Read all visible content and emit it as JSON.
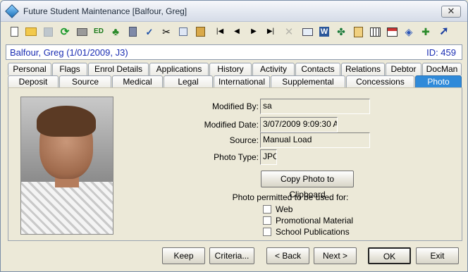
{
  "window": {
    "title": "Future Student Maintenance  [Balfour, Greg]",
    "close_glyph": "✕"
  },
  "toolbar": {
    "icons": [
      "new-doc-icon",
      "open-folder-icon",
      "save-icon",
      "refresh-icon",
      "print-icon",
      "edit-icon",
      "tree-icon",
      "calculator-icon",
      "spellcheck-icon",
      "cut-icon",
      "copy-icon",
      "paste-icon",
      "first-record-icon",
      "previous-record-icon",
      "next-record-icon",
      "last-record-icon",
      "delete-icon",
      "email-icon",
      "word-icon",
      "family-icon",
      "clipboard-icon",
      "calendar-icon",
      "schedule-icon",
      "tag-icon",
      "notes-icon",
      "go-icon"
    ],
    "edit_label": "ED"
  },
  "info": {
    "name": "Balfour, Greg (1/01/2009, J3)",
    "id": "ID: 459"
  },
  "tabs_row1": [
    "Personal",
    "Flags",
    "Enrol Details",
    "Applications",
    "History",
    "Activity",
    "Contacts",
    "Relations",
    "Debtor",
    "DocMan"
  ],
  "tabs_row2": [
    "Deposit",
    "Source",
    "Medical",
    "Legal",
    "International",
    "Supplemental",
    "Concessions",
    "Photo"
  ],
  "active_tab": "Photo",
  "photo_tab": {
    "modified_by_label": "Modified By:",
    "modified_by": "sa",
    "modified_date_label": "Modified Date:",
    "modified_date": "3/07/2009 9:09:30 A",
    "source_label": "Source:",
    "source": "Manual Load",
    "photo_type_label": "Photo Type:",
    "photo_type": "JPG",
    "copy_button": "Copy Photo to Clipboard",
    "permitted_heading": "Photo permitted to be used for:",
    "uses": [
      {
        "label": "Web",
        "checked": false
      },
      {
        "label": "Promotional Material",
        "checked": false
      },
      {
        "label": "School Publications",
        "checked": false
      }
    ]
  },
  "buttons": {
    "keep": "Keep",
    "criteria": "Criteria...",
    "back": "< Back",
    "next": "Next >",
    "ok": "OK",
    "exit": "Exit"
  }
}
